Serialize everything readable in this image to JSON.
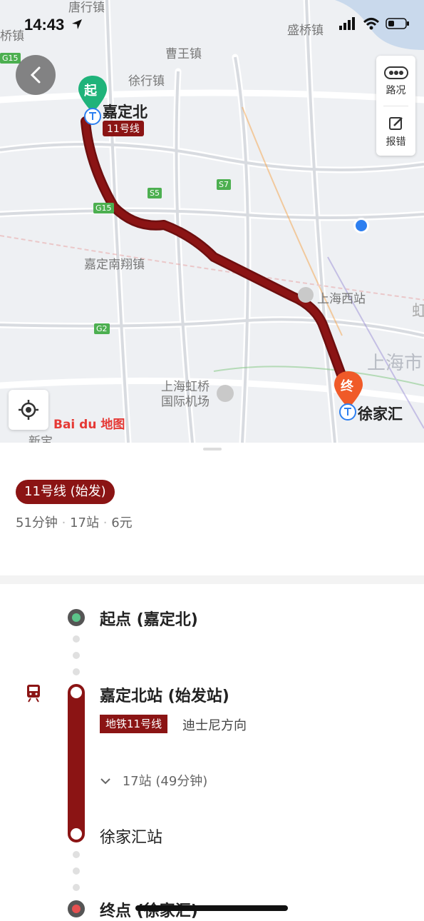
{
  "status_bar": {
    "time": "14:43",
    "location_arrow_icon": "location-arrow-icon",
    "signal_icon": "cellular-signal-icon",
    "wifi_icon": "wifi-icon",
    "battery_icon": "battery-icon"
  },
  "map": {
    "place_labels": [
      "唐行镇",
      "桥镇",
      "盛桥镇",
      "曹王镇",
      "徐行镇",
      "嘉定南翔镇",
      "上海西站",
      "上海虹桥国际机场",
      "上海市",
      "新宝",
      "虹"
    ],
    "road_badges": [
      "G15",
      "G15",
      "S5",
      "S7",
      "G2"
    ],
    "start_marker": "起",
    "end_marker": "终",
    "start_station": "嘉定北",
    "end_station": "徐家汇",
    "line_tag": "11号线",
    "logo_text": "Bai du 地图",
    "route_color": "#8b1414",
    "start_color": "#1fb37a",
    "end_color": "#f05a28"
  },
  "controls": {
    "back_icon": "chevron-left-icon",
    "traffic_label": "路况",
    "report_label": "报错",
    "locate_icon": "locate-icon"
  },
  "summary": {
    "tag": "11号线 (始发)",
    "duration": "51分钟",
    "stops": "17站",
    "price": "6元",
    "separator": "·"
  },
  "steps": {
    "start": "起点 (嘉定北)",
    "board_station": "嘉定北站 (始发站)",
    "subway_tag": "地铁11号线",
    "direction": "迪士尼方向",
    "expand": "17站 (49分钟)",
    "alight_station": "徐家汇站",
    "end": "终点 (徐家汇)"
  },
  "colors": {
    "accent": "#8b1414",
    "start_dot": "#5cc48a",
    "end_dot": "#e55050"
  }
}
